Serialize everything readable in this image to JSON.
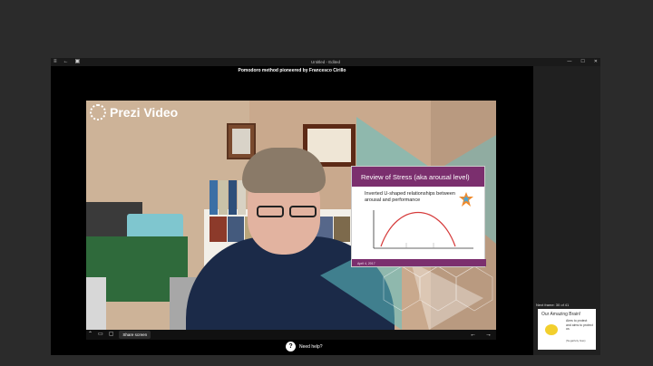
{
  "window": {
    "title": "Untitled - Edited",
    "controls": [
      "—",
      "☐",
      "✕"
    ]
  },
  "slide_caption": "Pomodoro method pioneered by Francesco Cirillo",
  "video": {
    "brand": "Prezi Video"
  },
  "overlay_card": {
    "title": "Review of Stress (aka arousal level)",
    "subtitle": "Inverted U-shaped relationships between arousal and performance",
    "footer": "April 4, 2017"
  },
  "toolbar": {
    "share_label": "Share screen"
  },
  "help": {
    "label": "Need help?"
  },
  "next_frame": {
    "label": "Next frame: 30 of 41",
    "title": "Our Amazing Brain!",
    "body": "Aims to protect and aims to protect us",
    "foot": "(Negativity bias)"
  }
}
